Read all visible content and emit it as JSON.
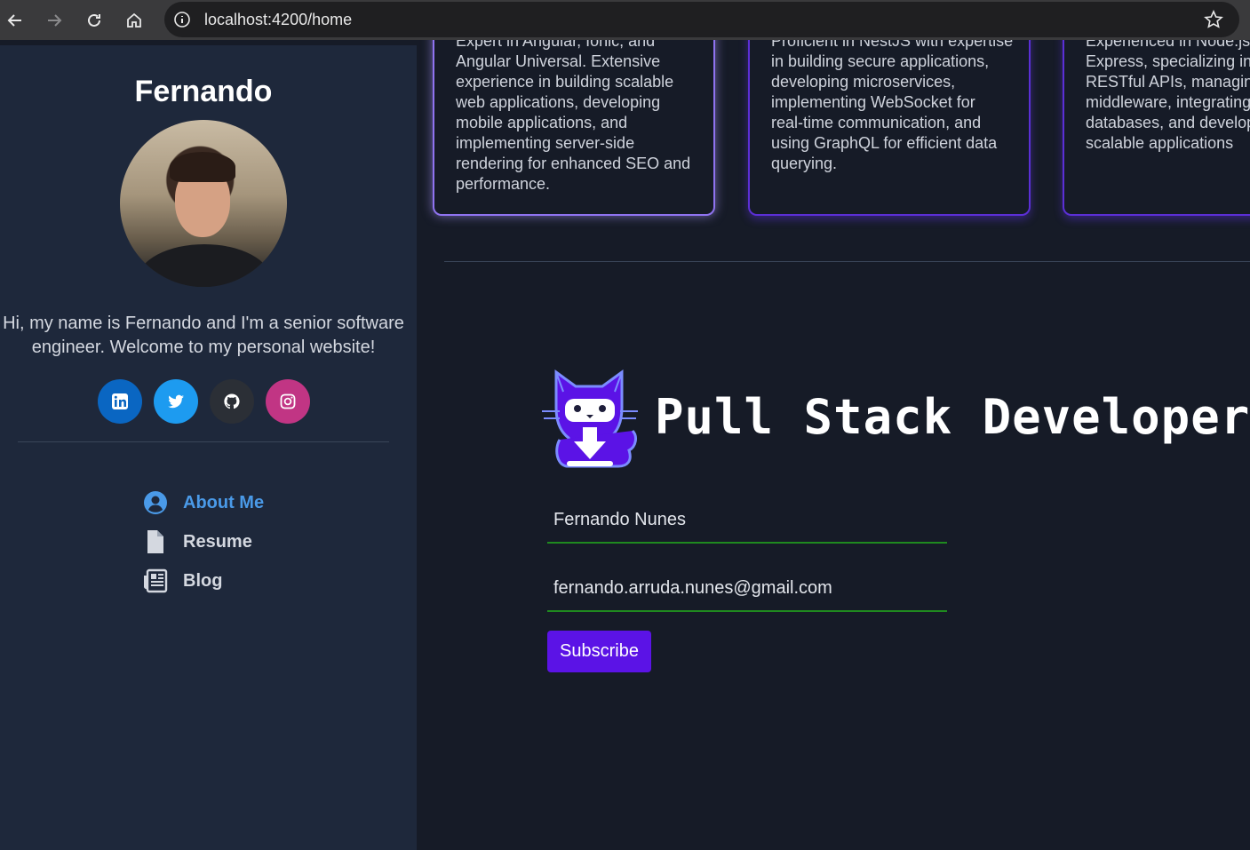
{
  "browser": {
    "url": "localhost:4200/home",
    "back_icon": "arrow-left-icon",
    "forward_icon": "arrow-right-icon",
    "reload_icon": "reload-icon",
    "home_icon": "home-icon",
    "info_icon": "info-icon",
    "bookmark_icon": "star-icon"
  },
  "sidebar": {
    "name": "Fernando",
    "intro": "Hi, my name is Fernando and I'm a senior software engineer. Welcome to my personal website!",
    "socials": [
      {
        "name": "linkedin",
        "icon": "linkedin-icon",
        "color": "#0a66c2"
      },
      {
        "name": "twitter",
        "icon": "twitter-icon",
        "color": "#1d9bf0"
      },
      {
        "name": "github",
        "icon": "github-icon",
        "color": "#2b2f36"
      },
      {
        "name": "instagram",
        "icon": "instagram-icon",
        "color": "#c13584"
      }
    ],
    "menu": [
      {
        "label": "About Me",
        "icon": "user-circle-icon",
        "active": true
      },
      {
        "label": "Resume",
        "icon": "file-icon",
        "active": false
      },
      {
        "label": "Blog",
        "icon": "newspaper-icon",
        "active": false
      }
    ]
  },
  "cards": [
    {
      "text": "Expert in Angular, Ionic, and\nAngular Universal. Extensive\nexperience in building scalable\nweb applications, developing\nmobile applications, and\nimplementing server-side\nrendering for enhanced SEO and\nperformance."
    },
    {
      "text": "Proficient in NestJS with expertise\nin building secure applications,\ndeveloping microservices,\nimplementing WebSocket for\nreal-time communication, and\nusing GraphQL for efficient data\nquerying."
    },
    {
      "text": "Experienced in Node.js a\nExpress, specializing in b\nRESTful APIs, managing\nmiddleware, integrating\ndatabases, and developi\nscalable applications"
    }
  ],
  "hero": {
    "title": "Pull Stack Developer",
    "logo_icon": "cat-download-icon"
  },
  "form": {
    "name_value": "Fernando Nunes",
    "email_value": "fernando.arruda.nunes@gmail.com",
    "subscribe_label": "Subscribe"
  },
  "colors": {
    "accent": "#5b13e6",
    "active_link": "#4a9ae8",
    "sidebar_bg": "#1e283b",
    "main_bg": "#161b27",
    "field_underline": "#1f8a1f"
  }
}
